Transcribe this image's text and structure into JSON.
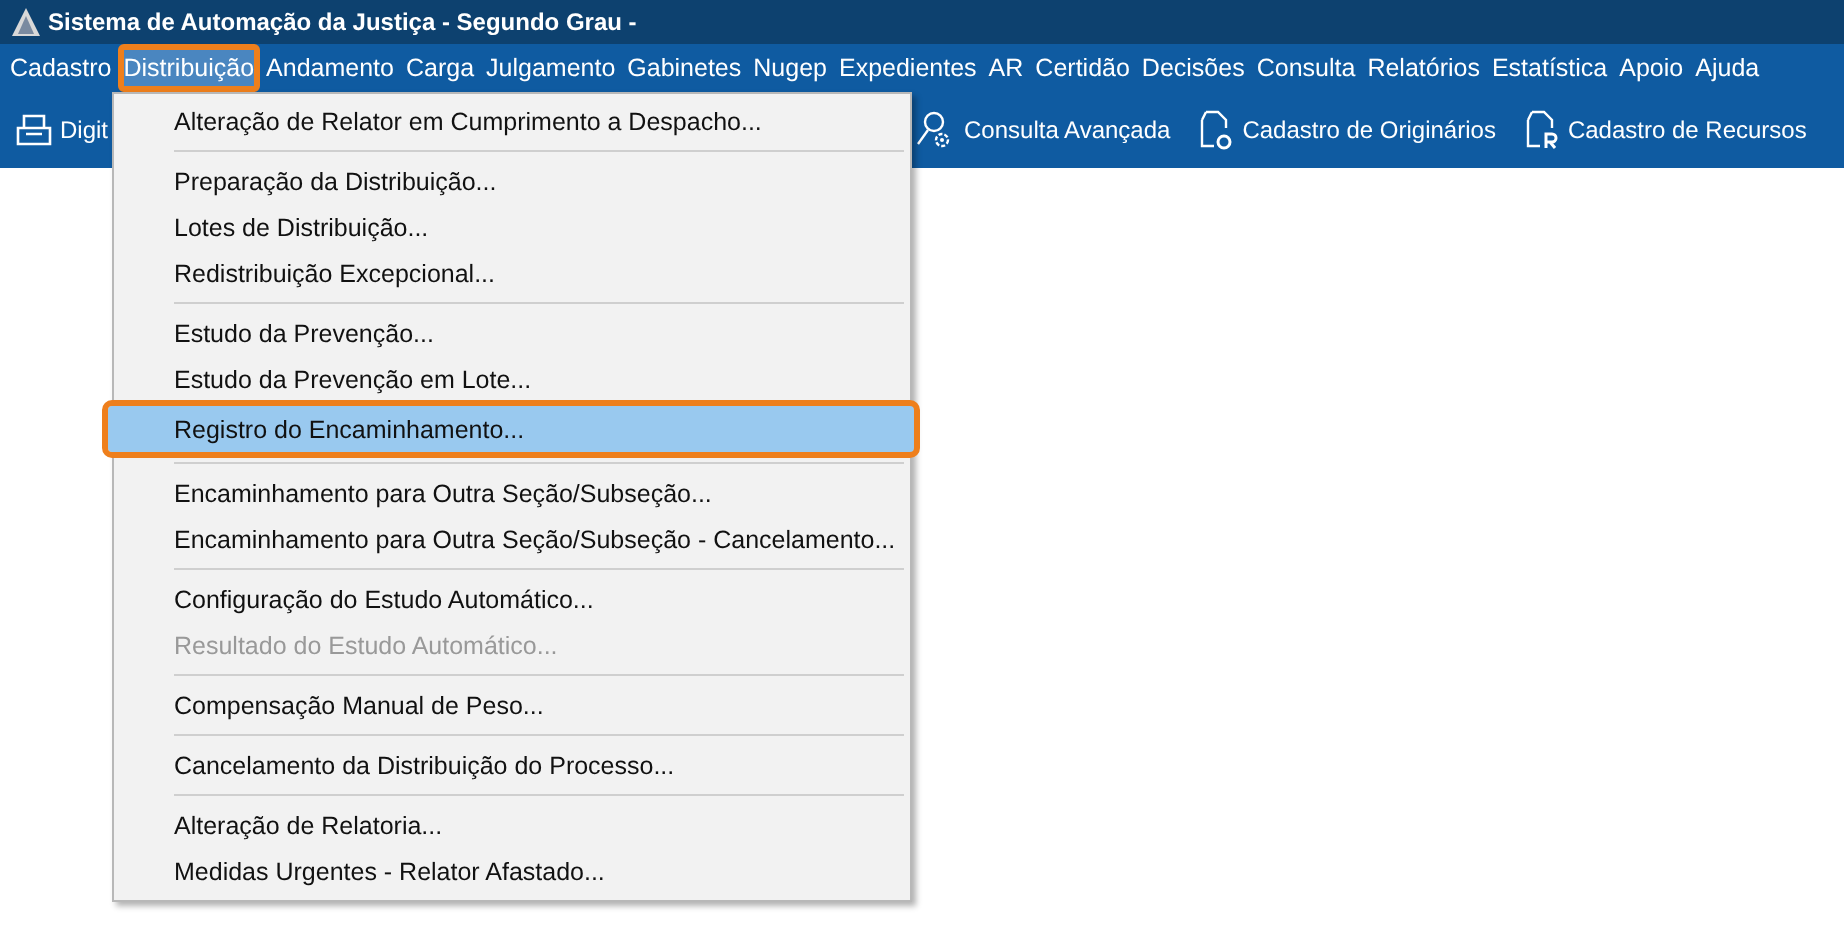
{
  "window": {
    "title": "Sistema de Automação da Justiça - Segundo Grau -"
  },
  "menu_bar": [
    {
      "label": "Cadastro",
      "selected": false,
      "highlighted": false
    },
    {
      "label": "Distribuição",
      "selected": true,
      "highlighted": true
    },
    {
      "label": "Andamento",
      "selected": false,
      "highlighted": false
    },
    {
      "label": "Carga",
      "selected": false,
      "highlighted": false
    },
    {
      "label": "Julgamento",
      "selected": false,
      "highlighted": false
    },
    {
      "label": "Gabinetes",
      "selected": false,
      "highlighted": false
    },
    {
      "label": "Nugep",
      "selected": false,
      "highlighted": false
    },
    {
      "label": "Expedientes",
      "selected": false,
      "highlighted": false
    },
    {
      "label": "AR",
      "selected": false,
      "highlighted": false
    },
    {
      "label": "Certidão",
      "selected": false,
      "highlighted": false
    },
    {
      "label": "Decisões",
      "selected": false,
      "highlighted": false
    },
    {
      "label": "Consulta",
      "selected": false,
      "highlighted": false
    },
    {
      "label": "Relatórios",
      "selected": false,
      "highlighted": false
    },
    {
      "label": "Estatística",
      "selected": false,
      "highlighted": false
    },
    {
      "label": "Apoio",
      "selected": false,
      "highlighted": false
    },
    {
      "label": "Ajuda",
      "selected": false,
      "highlighted": false
    }
  ],
  "toolbar": [
    {
      "kind": "tray",
      "label": "Digit"
    },
    {
      "kind": "search-gear",
      "label": "Consulta Avançada"
    },
    {
      "kind": "doc-o",
      "label": "Cadastro de Originários"
    },
    {
      "kind": "doc-r",
      "label": "Cadastro de Recursos"
    }
  ],
  "dropdown": {
    "groups": [
      [
        {
          "label": "Alteração de Relator em Cumprimento a Despacho...",
          "disabled": false,
          "selected": false,
          "highlighted": false
        }
      ],
      [
        {
          "label": "Preparação da Distribuição...",
          "disabled": false,
          "selected": false,
          "highlighted": false
        },
        {
          "label": "Lotes de Distribuição...",
          "disabled": false,
          "selected": false,
          "highlighted": false
        },
        {
          "label": "Redistribuição Excepcional...",
          "disabled": false,
          "selected": false,
          "highlighted": false
        }
      ],
      [
        {
          "label": "Estudo da Prevenção...",
          "disabled": false,
          "selected": false,
          "highlighted": false
        },
        {
          "label": "Estudo da Prevenção em Lote...",
          "disabled": false,
          "selected": false,
          "highlighted": false
        },
        {
          "label": "Registro do Encaminhamento...",
          "disabled": false,
          "selected": true,
          "highlighted": true
        }
      ],
      [
        {
          "label": "Encaminhamento para Outra Seção/Subseção...",
          "disabled": false,
          "selected": false,
          "highlighted": false
        },
        {
          "label": "Encaminhamento para Outra Seção/Subseção - Cancelamento...",
          "disabled": false,
          "selected": false,
          "highlighted": false
        }
      ],
      [
        {
          "label": "Configuração do Estudo Automático...",
          "disabled": false,
          "selected": false,
          "highlighted": false
        },
        {
          "label": "Resultado do Estudo Automático...",
          "disabled": true,
          "selected": false,
          "highlighted": false
        }
      ],
      [
        {
          "label": "Compensação Manual de Peso...",
          "disabled": false,
          "selected": false,
          "highlighted": false
        }
      ],
      [
        {
          "label": "Cancelamento da Distribuição do Processo...",
          "disabled": false,
          "selected": false,
          "highlighted": false
        }
      ],
      [
        {
          "label": "Alteração de Relatoria...",
          "disabled": false,
          "selected": false,
          "highlighted": false
        },
        {
          "label": "Medidas Urgentes - Relator Afastado...",
          "disabled": false,
          "selected": false,
          "highlighted": false
        }
      ]
    ]
  }
}
